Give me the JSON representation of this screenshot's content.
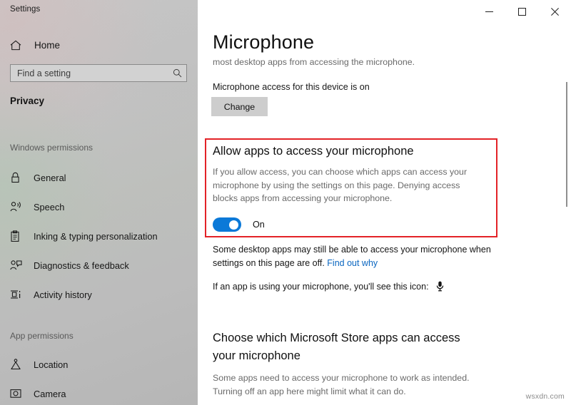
{
  "window": {
    "title": "Settings",
    "controls": [
      {
        "name": "minimize",
        "glyph": "─"
      },
      {
        "name": "maximize",
        "glyph": "□"
      },
      {
        "name": "close",
        "glyph": "✕"
      }
    ]
  },
  "sidebar": {
    "home_label": "Home",
    "search": {
      "placeholder": "Find a setting",
      "value": "",
      "icon": "search-icon"
    },
    "category": "Privacy",
    "groups": [
      {
        "heading": "Windows permissions",
        "items": [
          {
            "label": "General",
            "icon": "lock-icon"
          },
          {
            "label": "Speech",
            "icon": "speech-person-icon"
          },
          {
            "label": "Inking & typing personalization",
            "icon": "clipboard-icon"
          },
          {
            "label": "Diagnostics & feedback",
            "icon": "person-feedback-icon"
          },
          {
            "label": "Activity history",
            "icon": "activity-history-icon"
          }
        ]
      },
      {
        "heading": "App permissions",
        "items": [
          {
            "label": "Location",
            "icon": "location-pin-icon"
          },
          {
            "label": "Camera",
            "icon": "camera-icon"
          }
        ]
      }
    ]
  },
  "main": {
    "page_title": "Microphone",
    "page_subtitle": "most desktop apps from accessing the microphone.",
    "device_status": "Microphone access for this device is on",
    "change_button": "Change",
    "allow_section": {
      "heading": "Allow apps to access your microphone",
      "description": "If you allow access, you can choose which apps can access your microphone by using the settings on this page. Denying access blocks apps from accessing your microphone.",
      "toggle_state": "On",
      "toggle_on": true,
      "highlight_color": "#e32227",
      "toggle_color": "#0b79d8"
    },
    "desktop_note": {
      "text": "Some desktop apps may still be able to access your microphone when settings on this page are off. ",
      "link_text": "Find out why",
      "link_color": "#0a66c0"
    },
    "icon_note": {
      "text": "If an app is using your microphone, you'll see this icon:",
      "icon": "microphone-icon"
    },
    "store_section": {
      "heading": "Choose which Microsoft Store apps can access your microphone",
      "description": "Some apps need to access your microphone to work as intended. Turning off an app here might limit what it can do."
    }
  },
  "watermark": "wsxdn.com"
}
